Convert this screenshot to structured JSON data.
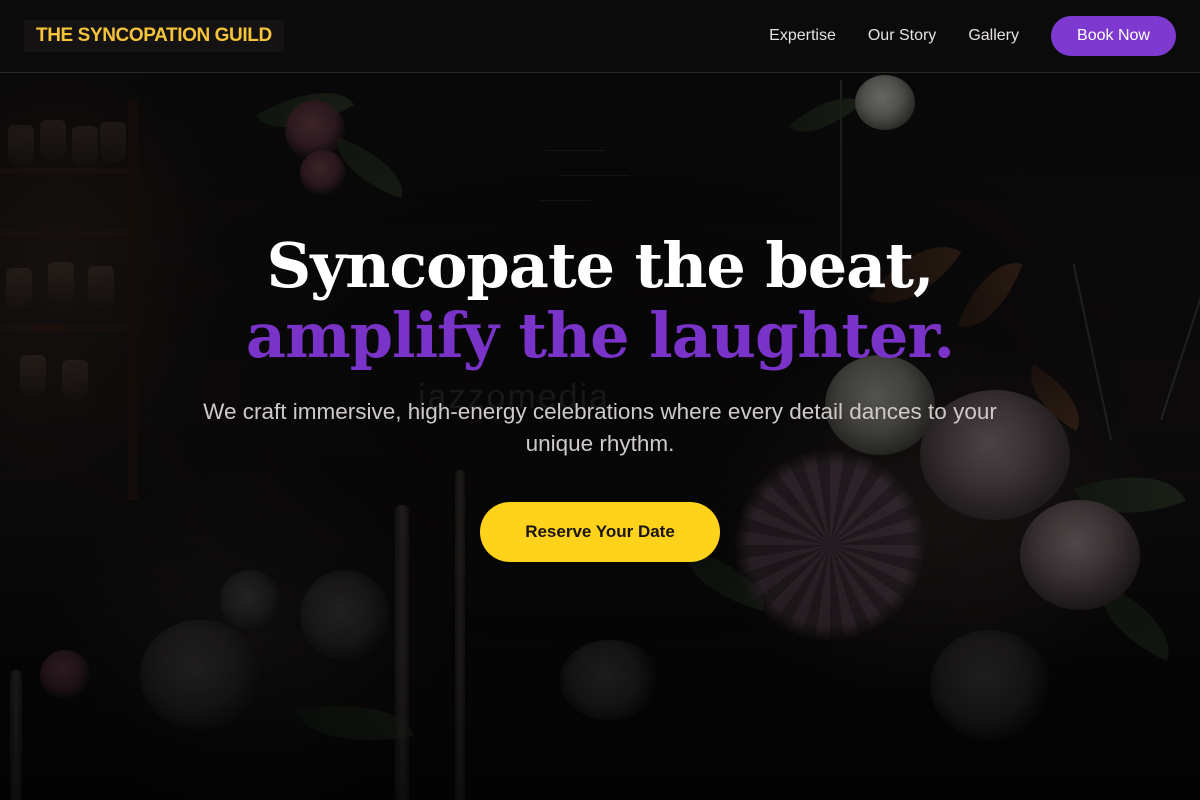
{
  "brand": {
    "name": "THE SYNCOPATION GUILD",
    "color": "#f5c43a"
  },
  "nav": {
    "links": [
      {
        "label": "Expertise"
      },
      {
        "label": "Our Story"
      },
      {
        "label": "Gallery"
      }
    ],
    "cta_label": "Book Now",
    "cta_color": "#7e3ad0"
  },
  "hero": {
    "headline_line1": "Syncopate the beat,",
    "headline_line2": "amplify the laughter.",
    "headline_accent_color": "#7a33c8",
    "subtitle": "We craft immersive, high-energy celebrations where every detail dances to your unique rhythm.",
    "cta_label": "Reserve Your Date",
    "cta_color": "#ffd21c"
  },
  "background": {
    "watermark_text": "jazzomedia"
  }
}
